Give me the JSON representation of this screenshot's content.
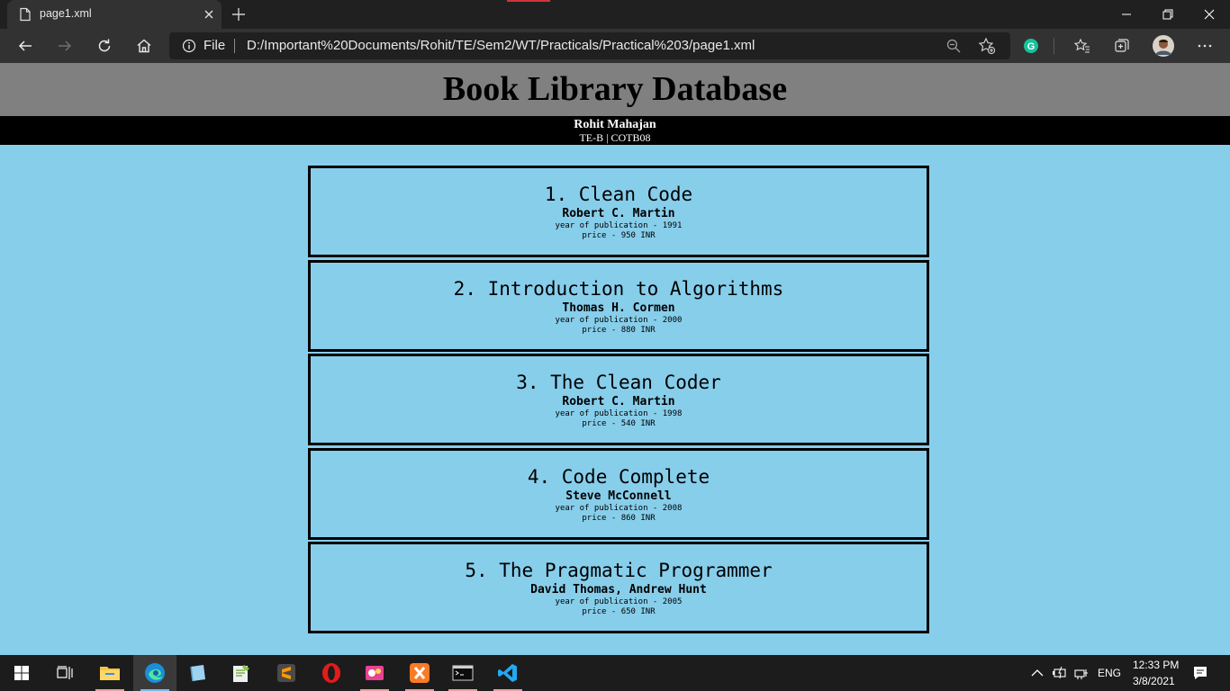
{
  "browser": {
    "tab_title": "page1.xml",
    "address_scheme_label": "File",
    "address_url": "D:/Important%20Documents/Rohit/TE/Sem2/WT/Practicals/Practical%203/page1.xml",
    "grammarly_letter": "G"
  },
  "page": {
    "title": "Book Library Database",
    "author_name": "Rohit Mahajan",
    "author_class": "TE-B | COTB08",
    "books": [
      {
        "title": "1. Clean Code",
        "author": "Robert C. Martin",
        "year": "year of publication - 1991",
        "price": "price - 950 INR"
      },
      {
        "title": "2. Introduction to Algorithms",
        "author": "Thomas H. Cormen",
        "year": "year of publication - 2000",
        "price": "price - 880 INR"
      },
      {
        "title": "3. The Clean Coder",
        "author": "Robert C. Martin",
        "year": "year of publication - 1998",
        "price": "price - 540 INR"
      },
      {
        "title": "4. Code Complete",
        "author": "Steve McConnell",
        "year": "year of publication - 2008",
        "price": "price - 860 INR"
      },
      {
        "title": "5. The Pragmatic Programmer",
        "author": "David Thomas, Andrew Hunt",
        "year": "year of publication - 2005",
        "price": "price - 650 INR"
      }
    ]
  },
  "taskbar": {
    "language": "ENG",
    "time": "12:33 PM",
    "date": "3/8/2021"
  },
  "colors": {
    "page_background": "#87ceeb",
    "banner_background": "#808080",
    "subbar_background": "#000000",
    "browser_chrome": "#202020",
    "toolbar": "#323232"
  }
}
